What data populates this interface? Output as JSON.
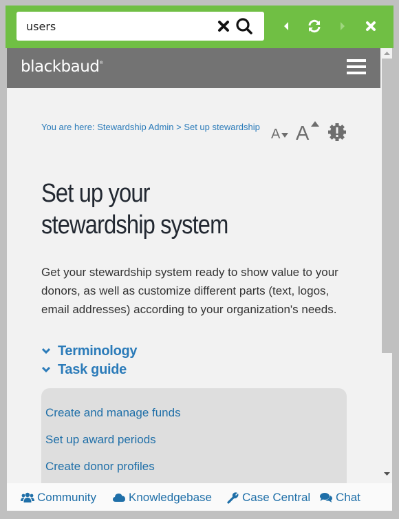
{
  "search": {
    "value": "users",
    "clear_icon": "times-icon",
    "search_icon": "magnifier-icon"
  },
  "toolbar_nav": {
    "back_icon": "caret-left-icon",
    "refresh_icon": "refresh-icon",
    "forward_icon": "caret-right-icon",
    "close_icon": "times-icon"
  },
  "header": {
    "logo": "blackbaud",
    "logo_mark": "®",
    "menu_icon": "hamburger-icon"
  },
  "breadcrumb": {
    "prefix": "You are here: ",
    "items": [
      {
        "label": "Stewardship Admin"
      },
      {
        "label": "Set up stewardship"
      }
    ],
    "separator": " > "
  },
  "tools": {
    "font_decrease": "font-decrease-icon",
    "font_increase": "font-increase-icon",
    "report_icon": "alert-badge-icon"
  },
  "page": {
    "title_line1": "Set up your",
    "title_line2": "stewardship system",
    "intro": "Get your stewardship system ready to show value to your donors, as well as customize different parts (text, logos, email addresses) according to your organization's needs."
  },
  "toggles": [
    {
      "label": "Terminology"
    },
    {
      "label": "Task guide"
    }
  ],
  "task_links": [
    {
      "label": "Create and manage funds"
    },
    {
      "label": "Set up award periods"
    },
    {
      "label": "Create donor profiles"
    }
  ],
  "footer": {
    "links": [
      {
        "label": "Community",
        "icon": "users-icon"
      },
      {
        "label": "Knowledgebase",
        "icon": "cloud-icon"
      },
      {
        "label": "Case Central",
        "icon": "wrench-icon"
      },
      {
        "label": "Chat",
        "icon": "comments-icon"
      }
    ]
  },
  "colors": {
    "toolbar_green": "#70bf44",
    "header_gray": "#737373",
    "link_blue": "#2b7bb9",
    "page_bg": "#f2f2f2",
    "panel_bg": "#dedede"
  }
}
